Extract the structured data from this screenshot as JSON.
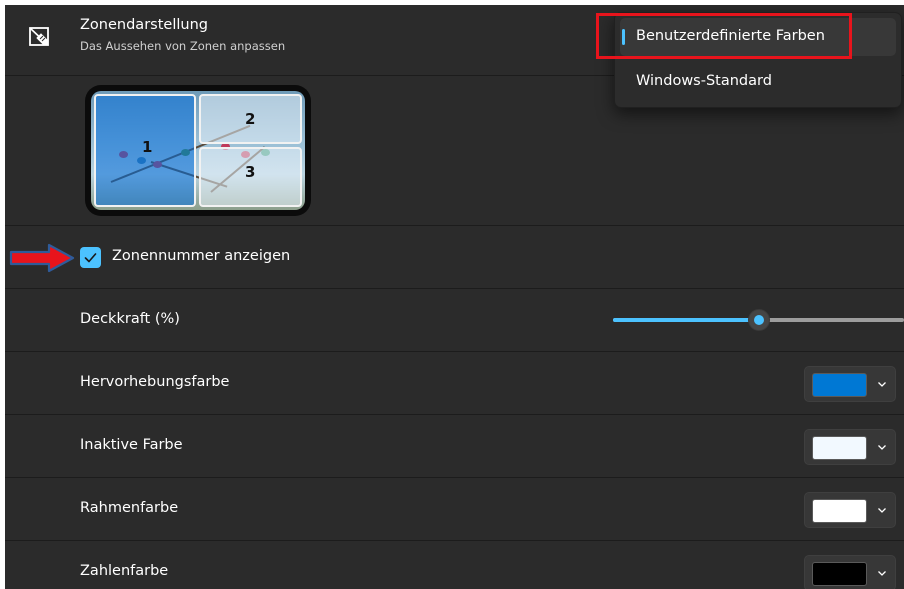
{
  "header": {
    "icon": "zone-layout-icon",
    "title": "Zonendarstellung",
    "subtitle": "Das Aussehen von Zonen anpassen"
  },
  "preview": {
    "zones": [
      "1",
      "2",
      "3"
    ]
  },
  "show_zone_number": {
    "label": "Zonennummer anzeigen",
    "checked": true,
    "annotation_icon": "red-arrow-icon"
  },
  "opacity": {
    "label": "Deckkraft (%)",
    "value_fraction": 0.51
  },
  "colors": [
    {
      "label": "Hervorhebungsfarbe",
      "color": "#0078d4"
    },
    {
      "label": "Inaktive Farbe",
      "color": "#f2f9ff"
    },
    {
      "label": "Rahmenfarbe",
      "color": "#ffffff"
    },
    {
      "label": "Zahlenfarbe",
      "color": "#000000"
    }
  ],
  "dropdown": {
    "options": [
      "Benutzerdefinierte Farben",
      "Windows-Standard"
    ],
    "selected_index": 0,
    "highlight_color": "#e8141c"
  },
  "accent_color": "#4cc2ff"
}
